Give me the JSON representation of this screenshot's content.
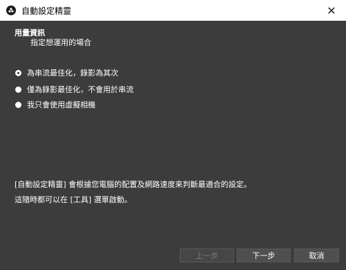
{
  "window": {
    "title": "自動設定精靈",
    "icon": "obs-icon",
    "close_glyph": "✕"
  },
  "header": {
    "title": "用量資訊",
    "subtitle": "指定想運用的場合"
  },
  "options": [
    {
      "label": "為串流最佳化，錄影為其次",
      "selected": true
    },
    {
      "label": "僅為錄影最佳化，不會用於串流",
      "selected": false
    },
    {
      "label": "我只會使用虛擬相機",
      "selected": false
    }
  ],
  "info": {
    "line1": "[自動設定精靈] 會根據您電腦的配置及網路速度來判斷最適合的設定。",
    "line2": "這隨時都可以在 [工具] 選單啟動。"
  },
  "buttons": {
    "back": "上一步",
    "next": "下一步",
    "cancel": "取消"
  },
  "colors": {
    "background": "#3c3c3c",
    "titlebar": "#ffffff",
    "button": "#4f4f4f"
  }
}
